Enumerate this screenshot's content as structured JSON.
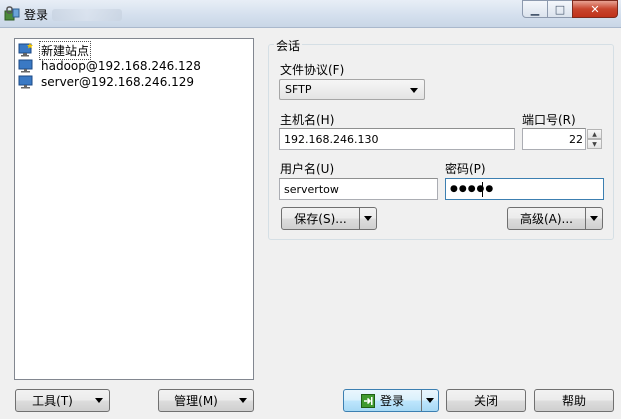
{
  "window": {
    "title": "登录"
  },
  "sites": [
    {
      "label": "新建站点",
      "icon": "new-site-icon",
      "selected": true
    },
    {
      "label": "hadoop@192.168.246.128",
      "icon": "monitor-icon",
      "selected": false
    },
    {
      "label": "server@192.168.246.129",
      "icon": "monitor-icon",
      "selected": false
    }
  ],
  "session": {
    "group_title": "会话",
    "protocol_label": "文件协议(F)",
    "protocol_value": "SFTP",
    "host_label": "主机名(H)",
    "host_value": "192.168.246.130",
    "port_label": "端口号(R)",
    "port_value": "22",
    "user_label": "用户名(U)",
    "user_value": "servertow",
    "password_label": "密码(P)",
    "password_mask": "●●●●●",
    "save_label": "保存(S)...",
    "advanced_label": "高级(A)..."
  },
  "footer": {
    "tools_label": "工具(T)",
    "manage_label": "管理(M)",
    "login_label": "登录",
    "close_label": "关闭",
    "help_label": "帮助"
  }
}
